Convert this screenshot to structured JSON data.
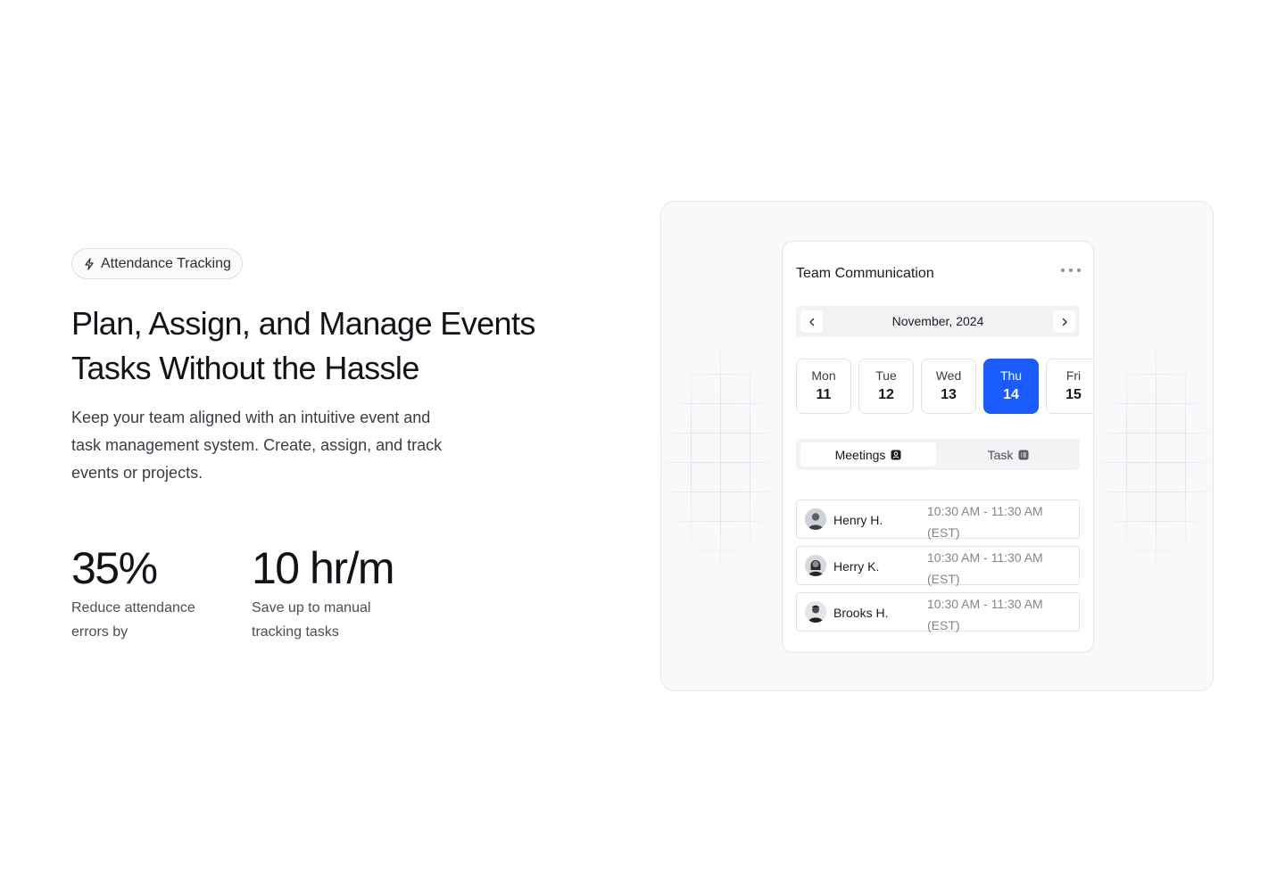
{
  "badge": {
    "label": "Attendance Tracking",
    "icon": "lightning-icon"
  },
  "headline": {
    "line1": "Plan, Assign, and Manage Events",
    "line2": "Tasks Without the Hassle"
  },
  "lead": {
    "line1": "Keep your team aligned with an intuitive event and",
    "line2": "task management system. Create, assign, and track",
    "line3": "events or projects."
  },
  "stats": [
    {
      "value": "35%",
      "desc_line1": "Reduce attendance",
      "desc_line2": "errors by"
    },
    {
      "value": "10 hr/m",
      "desc_line1": "Save up to manual",
      "desc_line2": "tracking tasks"
    }
  ],
  "card": {
    "title": "Team Communication",
    "month": "November, 2024",
    "days": [
      {
        "name": "Mon",
        "num": "11",
        "active": false
      },
      {
        "name": "Tue",
        "num": "12",
        "active": false
      },
      {
        "name": "Wed",
        "num": "13",
        "active": false
      },
      {
        "name": "Thu",
        "num": "14",
        "active": true
      },
      {
        "name": "Fri",
        "num": "15",
        "active": false
      }
    ],
    "tabs": {
      "meetings": "Meetings",
      "task": "Task"
    },
    "schedule": [
      {
        "name": "Henry H.",
        "time": "10:30 AM - 11:30 AM",
        "zone": "(EST)"
      },
      {
        "name": "Herry K.",
        "time": "10:30 AM - 11:30 AM",
        "zone": "(EST)"
      },
      {
        "name": "Brooks H.",
        "time": "10:30 AM - 11:30 AM",
        "zone": "(EST)"
      }
    ]
  },
  "colors": {
    "accent": "#1a5cff",
    "text": "#111318",
    "muted": "#83868e",
    "panel": "#f8f9fb"
  }
}
